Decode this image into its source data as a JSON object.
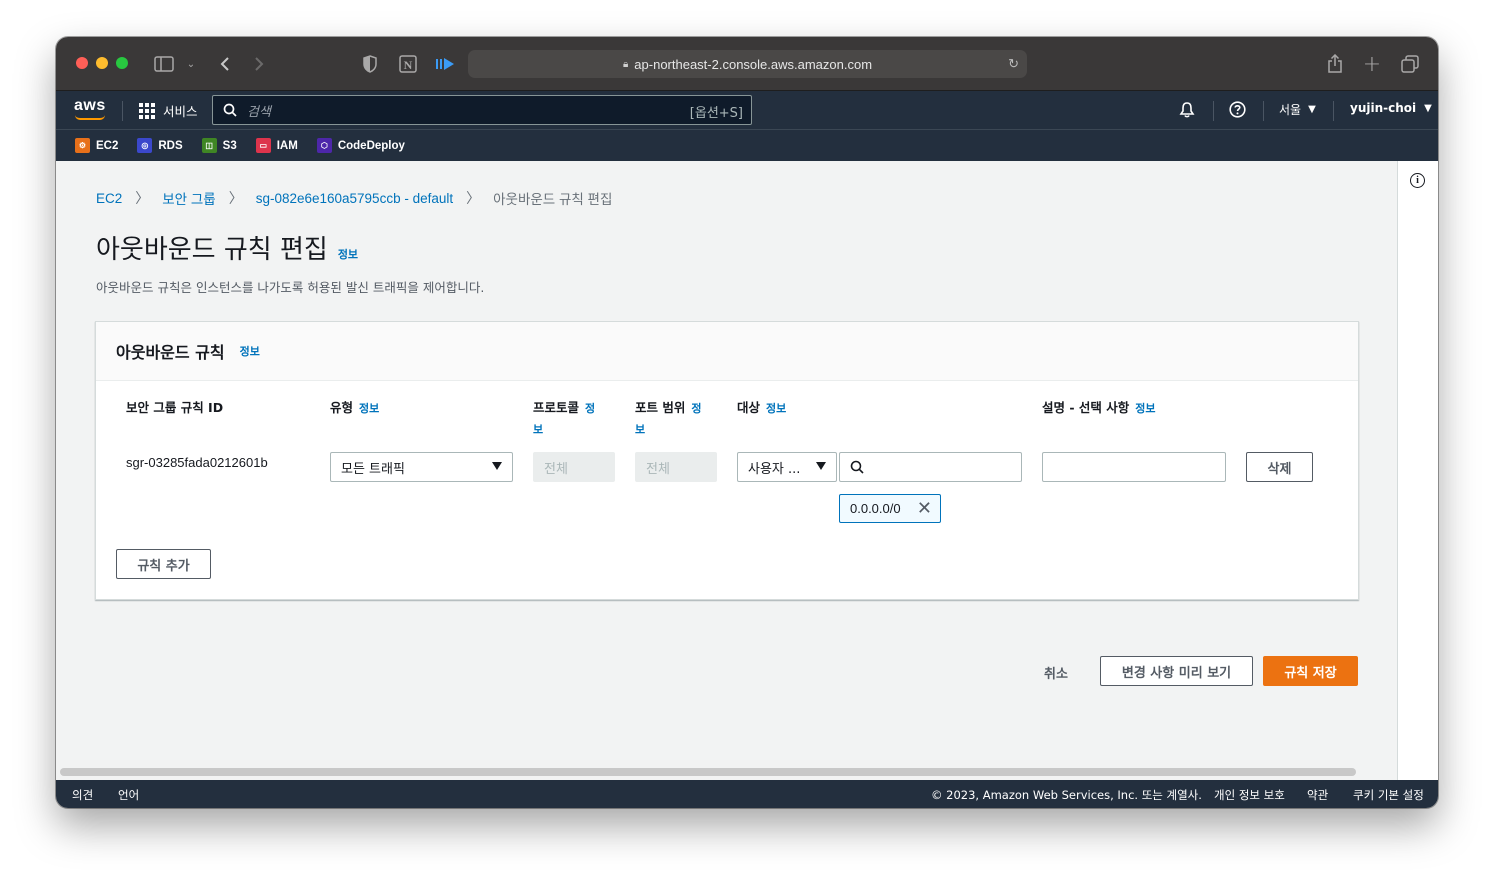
{
  "browser": {
    "url": "ap-northeast-2.console.aws.amazon.com"
  },
  "aws_nav": {
    "logo": "aws",
    "services_label": "서비스",
    "search_placeholder": "검색",
    "search_shortcut": "[옵션+S]",
    "region": "서울",
    "user": "yujin-choi"
  },
  "favorites": [
    {
      "label": "EC2",
      "color": "#e7701a"
    },
    {
      "label": "RDS",
      "color": "#3b48cc"
    },
    {
      "label": "S3",
      "color": "#3f8624"
    },
    {
      "label": "IAM",
      "color": "#dd344c"
    },
    {
      "label": "CodeDeploy",
      "color": "#4d27aa"
    }
  ],
  "breadcrumb": {
    "items": [
      "EC2",
      "보안 그룹",
      "sg-082e6e160a5795ccb - default"
    ],
    "current": "아웃바운드 규칙 편집"
  },
  "page": {
    "title": "아웃바운드 규칙 편집",
    "info": "정보",
    "description": "아웃바운드 규칙은 인스턴스를 나가도록 허용된 발신 트래픽을 제어합니다."
  },
  "panel": {
    "title": "아웃바운드 규칙",
    "info": "정보",
    "columns": {
      "rule_id": "보안 그룹 규칙 ID",
      "type": "유형",
      "protocol": "프로토콜",
      "port_range": "포트 범위",
      "destination": "대상",
      "description": "설명 - 선택 사항",
      "info": "정보",
      "info_a": "정",
      "info_b": "보"
    },
    "rule": {
      "id": "sgr-03285fada0212601b",
      "type": "모든 트래픽",
      "protocol": "전체",
      "port_range": "전체",
      "destination_type": "사용자 ...",
      "destination_token": "0.0.0.0/0",
      "description": "",
      "delete_label": "삭제"
    },
    "add_rule_label": "규칙 추가"
  },
  "actions": {
    "cancel": "취소",
    "preview": "변경 사항 미리 보기",
    "save": "규칙 저장"
  },
  "footer": {
    "feedback": "의견",
    "language": "언어",
    "copyright": "© 2023, Amazon Web Services, Inc. 또는 계열사.",
    "privacy": "개인 정보 보호",
    "terms": "약관",
    "cookies": "쿠키 기본 설정"
  }
}
